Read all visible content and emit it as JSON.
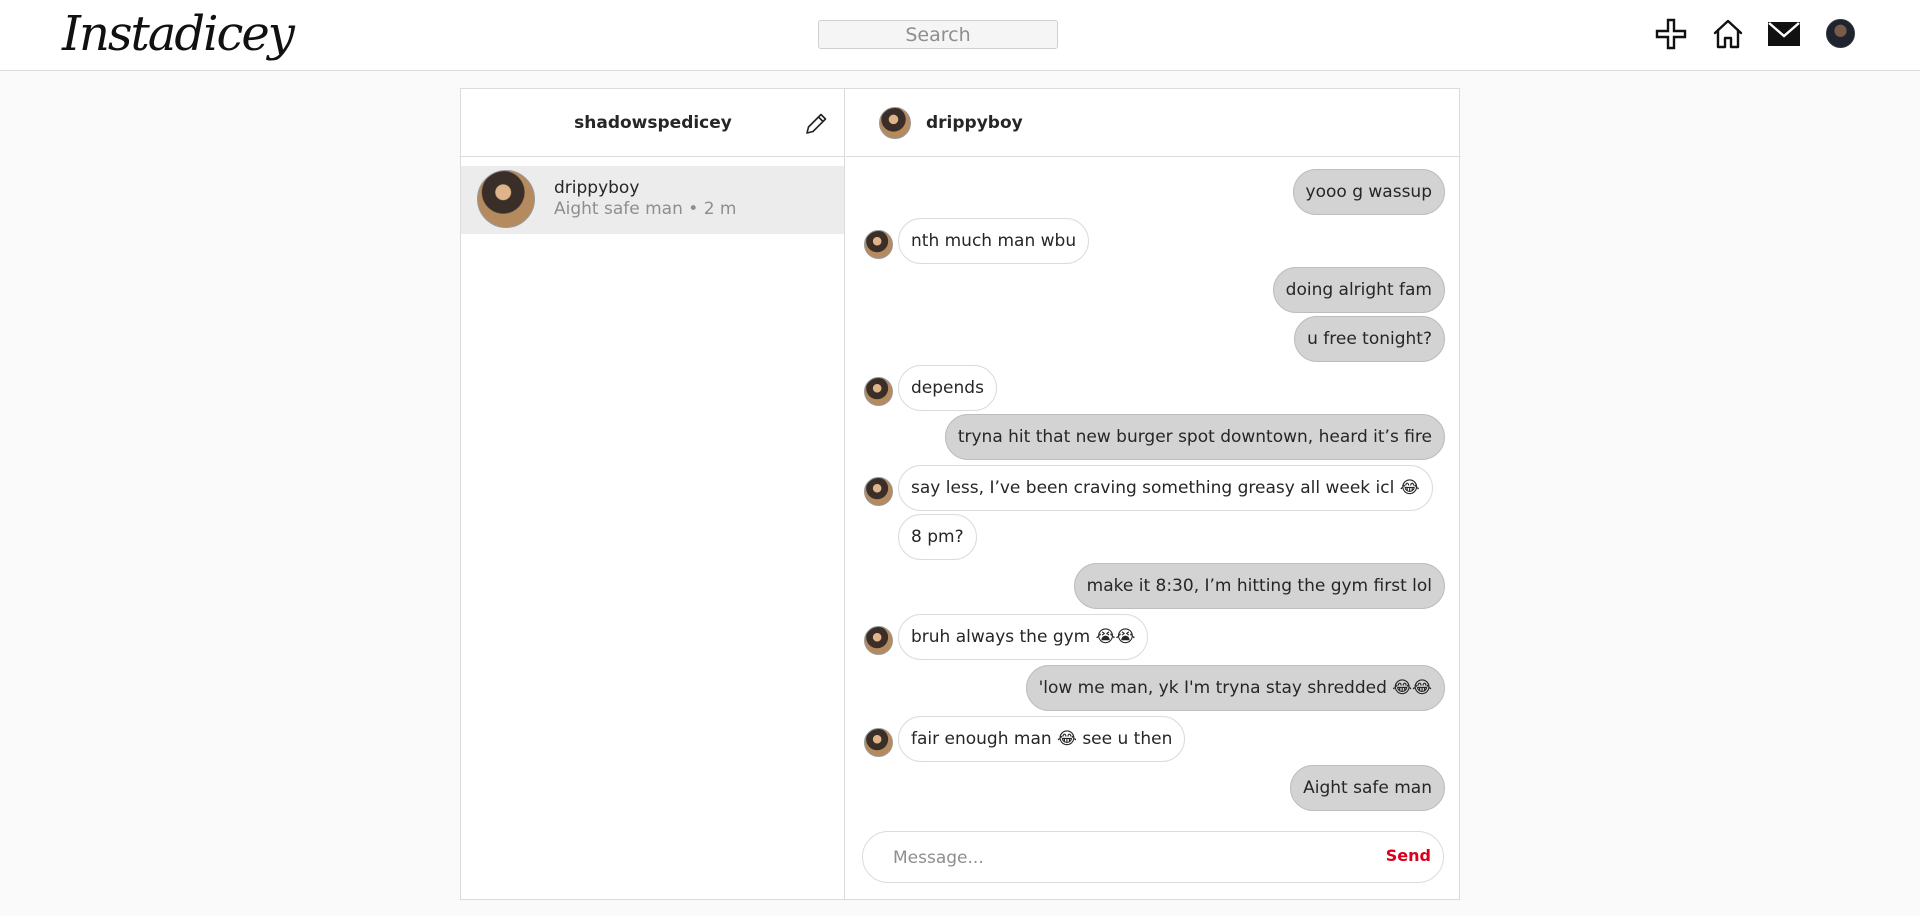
{
  "app": {
    "logo": "Instadicey"
  },
  "search": {
    "placeholder": "Search"
  },
  "sidebar": {
    "username": "shadowspedicey",
    "conversations": [
      {
        "name": "drippyboy",
        "preview": "Aight safe man • 2 m"
      }
    ]
  },
  "chat": {
    "partner": "drippyboy",
    "messages": [
      {
        "dir": "out",
        "text": "yooo g wassup"
      },
      {
        "dir": "in",
        "text": "nth much man wbu",
        "avatar": true
      },
      {
        "dir": "out",
        "text": "doing alright fam"
      },
      {
        "dir": "out",
        "text": "u free tonight?"
      },
      {
        "dir": "in",
        "text": "depends",
        "avatar": true
      },
      {
        "dir": "out",
        "text": "tryna hit that new burger spot downtown, heard it’s fire"
      },
      {
        "dir": "in",
        "text": "say less, I’ve been craving something greasy all week icl 😂",
        "avatar": true
      },
      {
        "dir": "in",
        "text": "8 pm?",
        "avatar": false
      },
      {
        "dir": "out",
        "text": "make it 8:30, I’m hitting the gym first lol"
      },
      {
        "dir": "in",
        "text": "bruh always the gym 😭😭",
        "avatar": true
      },
      {
        "dir": "out",
        "text": "'low me man, yk I'm tryna stay shredded 😂😂"
      },
      {
        "dir": "in",
        "text": "fair enough man 😂 see u then",
        "avatar": true
      },
      {
        "dir": "out",
        "text": "Aight safe man"
      }
    ],
    "composer": {
      "placeholder": "Message...",
      "send_label": "Send"
    }
  },
  "icons": [
    "new-post-icon",
    "home-icon",
    "mail-icon",
    "edit-icon"
  ]
}
